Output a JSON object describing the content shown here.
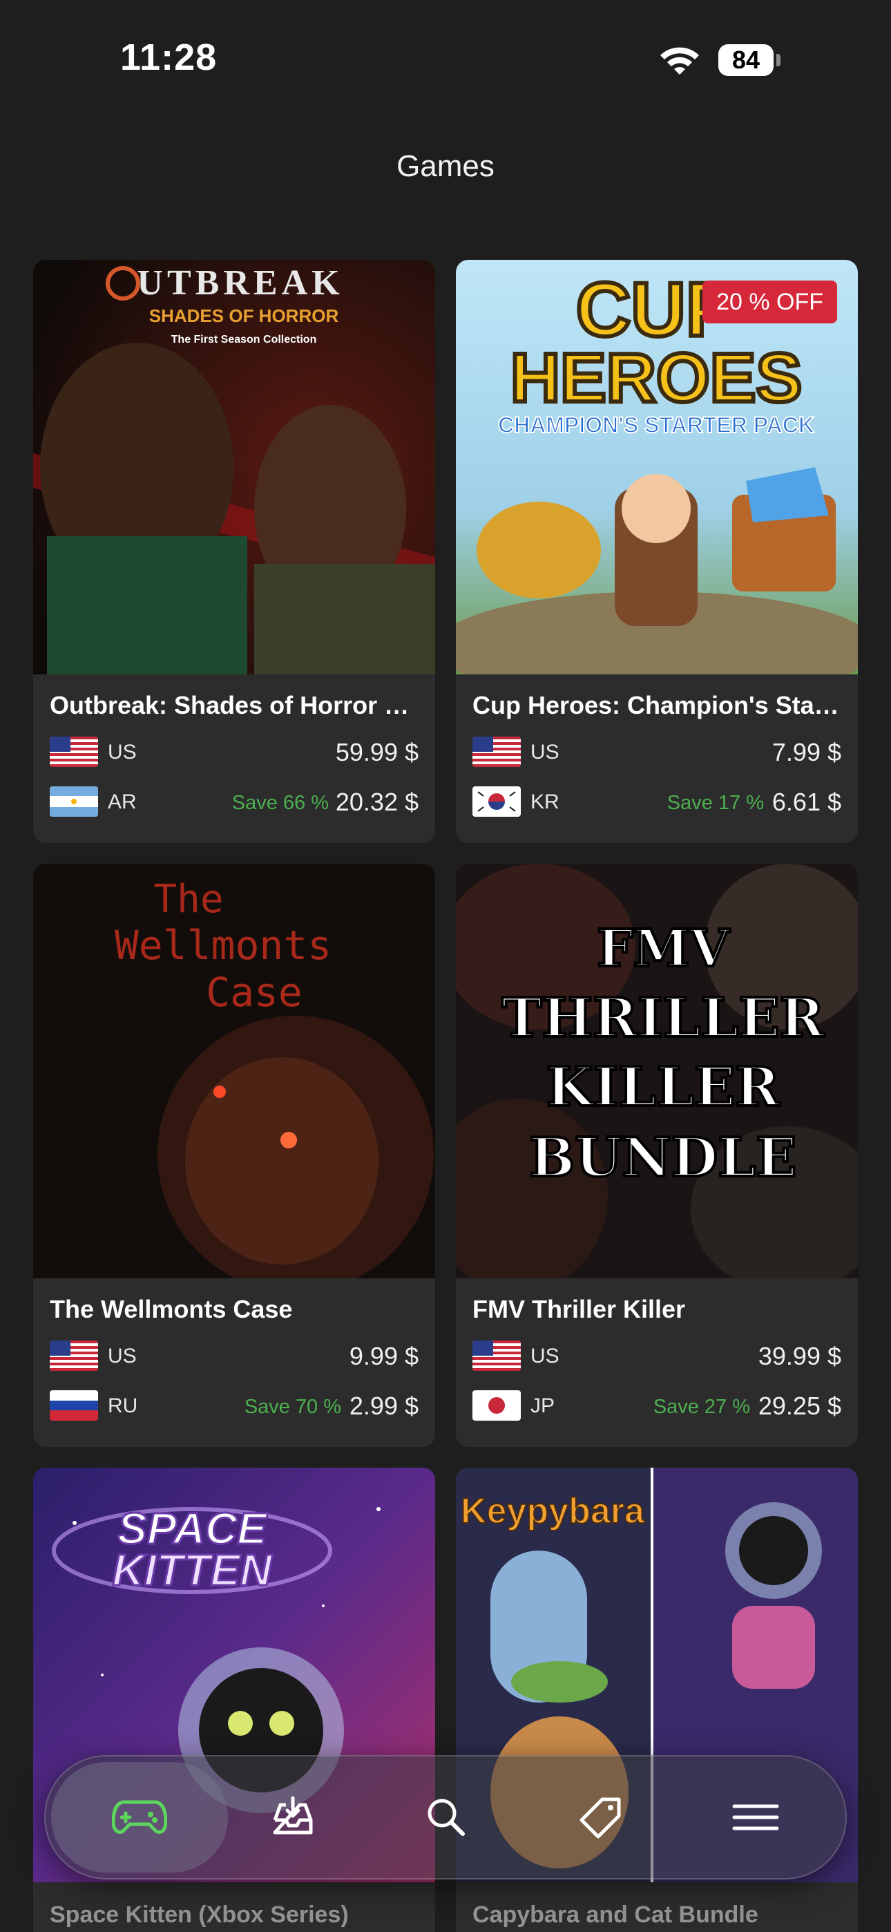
{
  "status_bar": {
    "time": "11:28",
    "battery": "84"
  },
  "header": {
    "title": "Games"
  },
  "cards": [
    {
      "title": "Outbreak: Shades of Horror Th…",
      "art_text": {
        "line1": "UTBREAK",
        "line2": "SHADES OF HORROR",
        "line3": "The First Season Collection"
      },
      "rows": [
        {
          "region": "US",
          "price": "59.99 $"
        },
        {
          "region": "AR",
          "save": "Save 66 %",
          "price": "20.32 $"
        }
      ]
    },
    {
      "title": "Cup Heroes: Champion's Starte…",
      "badge": "20 % OFF",
      "art_text": {
        "line1": "CUP",
        "line2": "HEROES",
        "line3": "CHAMPION'S STARTER PACK"
      },
      "rows": [
        {
          "region": "US",
          "price": "7.99 $"
        },
        {
          "region": "KR",
          "save": "Save 17 %",
          "price": "6.61 $"
        }
      ]
    },
    {
      "title": "The Wellmonts Case",
      "art_text": {
        "line1": "The",
        "line2": "Wellmonts",
        "line3": "Case"
      },
      "rows": [
        {
          "region": "US",
          "price": "9.99 $"
        },
        {
          "region": "RU",
          "save": "Save 70 %",
          "price": "2.99 $"
        }
      ]
    },
    {
      "title": "FMV Thriller Killer",
      "art_text": {
        "line1": "FMV",
        "line2": "THRILLER",
        "line3": "KILLER",
        "line4": "BUNDLE"
      },
      "rows": [
        {
          "region": "US",
          "price": "39.99 $"
        },
        {
          "region": "JP",
          "save": "Save 27 %",
          "price": "29.25 $"
        }
      ]
    },
    {
      "title": "Space Kitten (Xbox Series)",
      "art_text": {
        "line1": "SPACE",
        "line2": "KITTEN"
      }
    },
    {
      "title": "Capybara and Cat Bundle",
      "art_text": {
        "line1": "Keypybara"
      }
    }
  ],
  "bottom_nav": {
    "items": [
      {
        "icon": "gamepad-icon",
        "active": true
      },
      {
        "icon": "inbox-download-icon"
      },
      {
        "icon": "search-icon"
      },
      {
        "icon": "tag-icon"
      },
      {
        "icon": "menu-icon"
      }
    ]
  },
  "colors": {
    "save_green": "#4caf50",
    "badge_red": "#d6283a",
    "active_nav": "#5cd65c"
  }
}
